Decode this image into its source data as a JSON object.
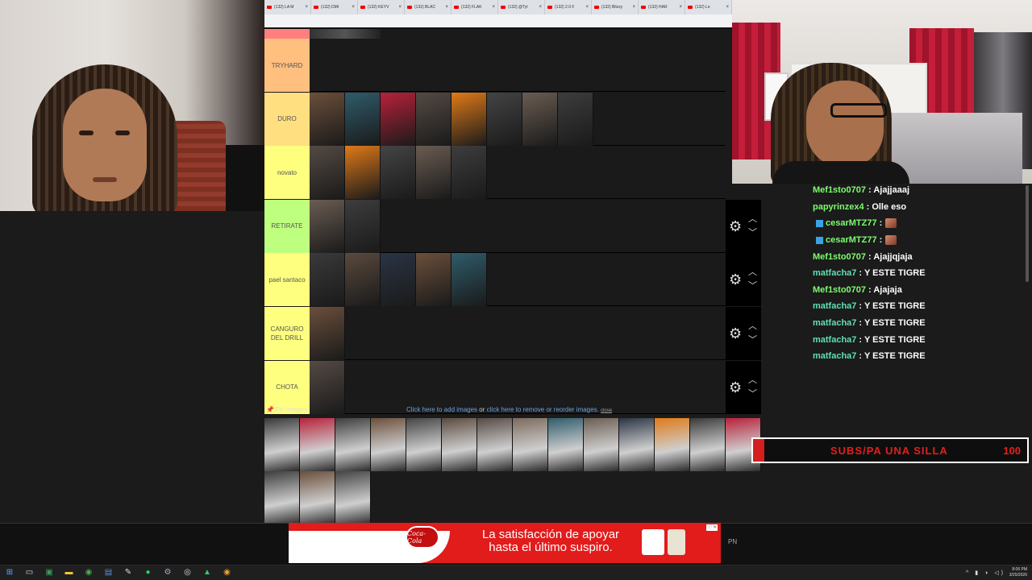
{
  "browser": {
    "tabs": [
      {
        "label": "(132) LA M"
      },
      {
        "label": "(132) DMI"
      },
      {
        "label": "(132) KEYV"
      },
      {
        "label": "(132) BLAC"
      },
      {
        "label": "(132) FLAK"
      },
      {
        "label": "(132) @Tyl"
      },
      {
        "label": "(132) 2.0 F"
      },
      {
        "label": "(132) Blizzy"
      },
      {
        "label": "(132) HAR"
      },
      {
        "label": "(132) Le"
      }
    ]
  },
  "tierlist": {
    "tiers": [
      {
        "label": "TRYHARD",
        "color": "#ffbf7f",
        "items": 0
      },
      {
        "label": "DURO",
        "color": "#ffdf7f",
        "items": 8
      },
      {
        "label": "novato",
        "color": "#ffff7f",
        "items": 5
      },
      {
        "label": "RETIRATE",
        "color": "#bfff7f",
        "items": 2
      },
      {
        "label": "pael santaco",
        "color": "#ffff7f",
        "items": 5
      },
      {
        "label": "CANGURO DEL DRILL",
        "color": "#ffff7f",
        "items": 1
      },
      {
        "label": "CHOTA",
        "color": "#ffff7f",
        "items": 1
      }
    ],
    "pin_label": "Pin Images",
    "add_link": "Click here to add images",
    "or_text": "or",
    "remove_link": "click here to remove or reorder images.",
    "close_link": "close",
    "pool_count": 17
  },
  "chat": {
    "messages": [
      {
        "user": "Mef1sto0707",
        "color": "#7dfc6e",
        "text": ": Ajajjaaaj",
        "badge": false,
        "emote": false
      },
      {
        "user": "papyrinzex4",
        "color": "#7dfc6e",
        "text": ": Olle eso",
        "badge": false,
        "emote": false
      },
      {
        "user": "cesarMTZ77",
        "color": "#7dfc6e",
        "text": ":",
        "badge": true,
        "emote": true
      },
      {
        "user": "cesarMTZ77",
        "color": "#7dfc6e",
        "text": ":",
        "badge": true,
        "emote": true
      },
      {
        "user": "Mef1sto0707",
        "color": "#7dfc6e",
        "text": ": Ajajjqjaja",
        "badge": false,
        "emote": false
      },
      {
        "user": "matfacha7",
        "color": "#5fe0b0",
        "text": ": Y ESTE TIGRE",
        "badge": false,
        "emote": false
      },
      {
        "user": "Mef1sto0707",
        "color": "#7dfc6e",
        "text": ": Ajajaja",
        "badge": false,
        "emote": false
      },
      {
        "user": "matfacha7",
        "color": "#5fe0b0",
        "text": ": Y ESTE TIGRE",
        "badge": false,
        "emote": false
      },
      {
        "user": "matfacha7",
        "color": "#5fe0b0",
        "text": ": Y ESTE TIGRE",
        "badge": false,
        "emote": false
      },
      {
        "user": "matfacha7",
        "color": "#5fe0b0",
        "text": ": Y ESTE TIGRE",
        "badge": false,
        "emote": false
      },
      {
        "user": "matfacha7",
        "color": "#5fe0b0",
        "text": ": Y ESTE TIGRE",
        "badge": false,
        "emote": false
      }
    ]
  },
  "goal": {
    "label": "SUBS/PA UNA SILLA",
    "value": "100",
    "progress": 0.04
  },
  "ad": {
    "brand": "Coca-Cola",
    "line1": "La satisfacción de apoyar",
    "line2": "hasta el último suspiro.",
    "close_label": "ⓘ ✕"
  },
  "overlay_tag": "PN",
  "taskbar": {
    "time": "8:06 PM",
    "date": "3/25/2026",
    "icons": [
      "start-icon",
      "search-icon",
      "terminal-icon",
      "file-explorer-icon",
      "chrome-icon",
      "app-icon",
      "pen-icon",
      "spotify-icon",
      "steam-icon",
      "obs-icon",
      "game-icon",
      "chrome-canary-icon"
    ]
  }
}
